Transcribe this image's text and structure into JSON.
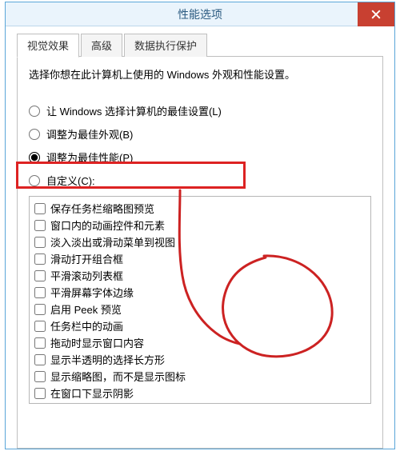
{
  "window": {
    "title": "性能选项"
  },
  "tabs": {
    "visual": "视觉效果",
    "advanced": "高级",
    "dep": "数据执行保护"
  },
  "intro": "选择你想在此计算机上使用的 Windows 外观和性能设置。",
  "radios": {
    "let_windows": "让 Windows 选择计算机的最佳设置(L)",
    "best_appearance": "调整为最佳外观(B)",
    "best_performance": "调整为最佳性能(P)",
    "custom": "自定义(C):"
  },
  "checks": {
    "c0": "保存任务栏缩略图预览",
    "c1": "窗口内的动画控件和元素",
    "c2": "淡入淡出或滑动菜单到视图",
    "c3": "滑动打开组合框",
    "c4": "平滑滚动列表框",
    "c5": "平滑屏幕字体边缘",
    "c6": "启用 Peek 预览",
    "c7": "任务栏中的动画",
    "c8": "拖动时显示窗口内容",
    "c9": "显示半透明的选择长方形",
    "c10": "显示缩略图，而不是显示图标",
    "c11": "在窗口下显示阴影"
  },
  "annotation": {
    "color": "#cc2222"
  }
}
